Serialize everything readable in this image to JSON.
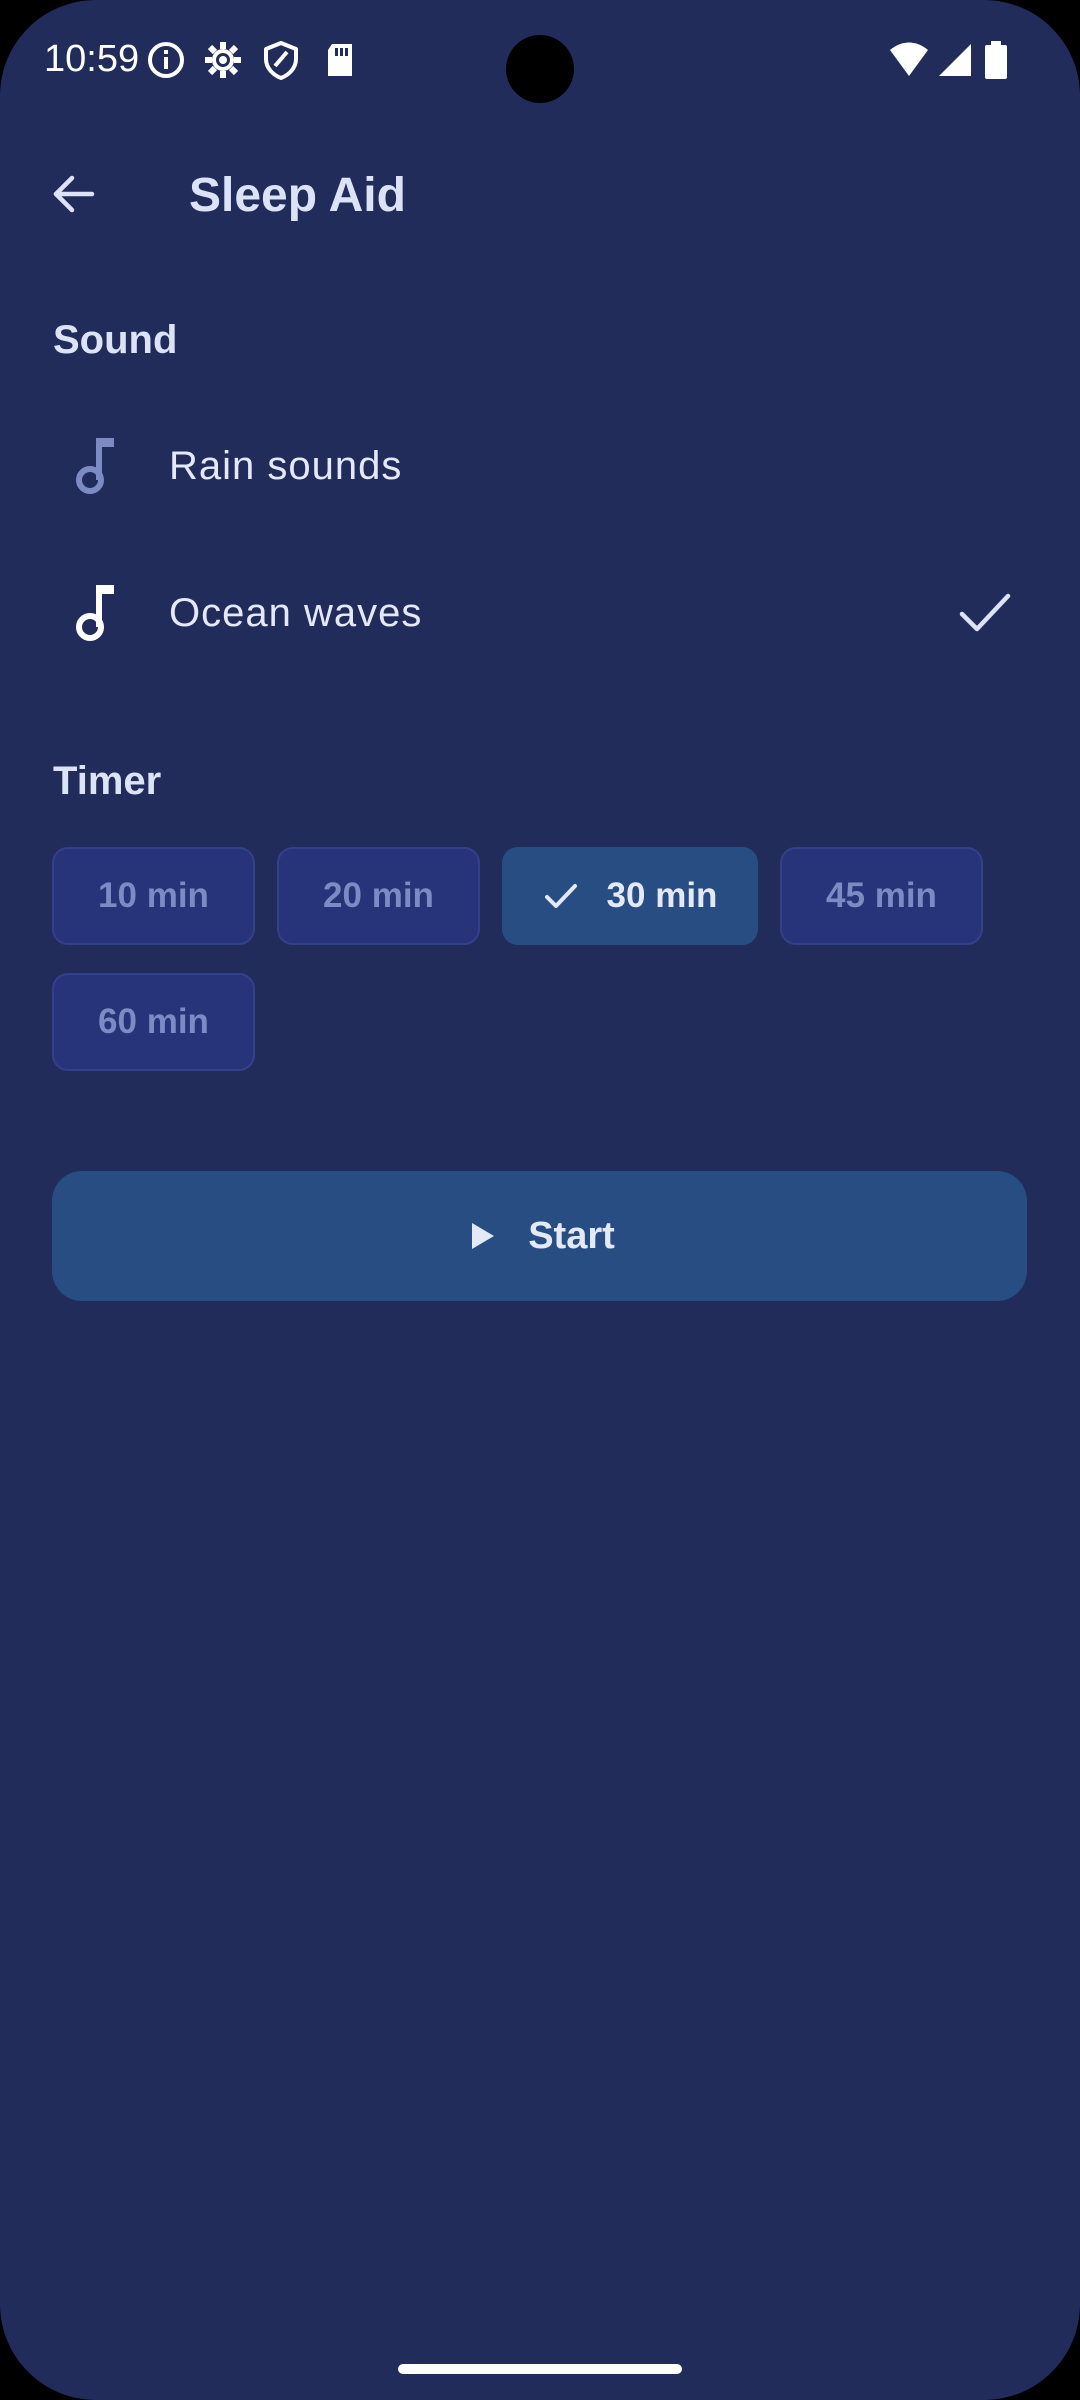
{
  "status_bar": {
    "time": "10:59",
    "icons": [
      "info-icon",
      "gear-icon",
      "shield-icon",
      "sd-card-icon",
      "wifi-icon",
      "signal-icon",
      "battery-icon"
    ]
  },
  "header": {
    "title": "Sleep Aid",
    "back_icon": "arrow-left-icon"
  },
  "sound_section": {
    "label": "Sound",
    "items": [
      {
        "label": "Rain sounds",
        "icon": "music-note-icon",
        "selected": false
      },
      {
        "label": "Ocean waves",
        "icon": "music-note-icon",
        "selected": true
      }
    ]
  },
  "timer_section": {
    "label": "Timer",
    "options": [
      {
        "label": "10 min",
        "selected": false
      },
      {
        "label": "20 min",
        "selected": false
      },
      {
        "label": "30 min",
        "selected": true
      },
      {
        "label": "45 min",
        "selected": false
      },
      {
        "label": "60 min",
        "selected": false
      }
    ]
  },
  "start_button": {
    "label": "Start",
    "icon": "play-icon"
  },
  "colors": {
    "background": "#222c5a",
    "chip": "#273479",
    "selected": "#284d82",
    "text": "#dde3f7",
    "muted": "#7c8bc4"
  }
}
